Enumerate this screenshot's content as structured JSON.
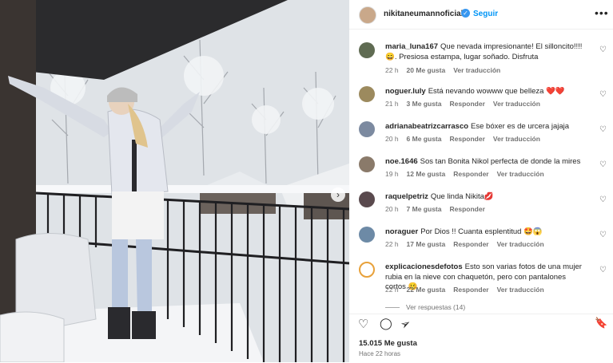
{
  "post": {
    "username": "nikitaneumannoficial",
    "follow_label": "Seguir",
    "more_label": "•••",
    "next_label": "›"
  },
  "comments": [
    {
      "user": "maria_luna167",
      "text": "Que nevada impresionante! El sillon­cito!!!!😄. Presiosa estampa, lugar soñado. Disfruta",
      "time": "22 h",
      "likes": "20 Me gusta",
      "reply": "",
      "translate": "Ver traducción"
    },
    {
      "user": "noguer.luly",
      "text": "Está nevando wowww que belleza ❤️❤️",
      "time": "21 h",
      "likes": "3 Me gusta",
      "reply": "Responder",
      "translate": "Ver traducción"
    },
    {
      "user": "adrianabeatrizcarrasco",
      "text": "Ese bóxer es de urcera jajaja",
      "time": "20 h",
      "likes": "6 Me gusta",
      "reply": "Responder",
      "translate": "Ver traducción"
    },
    {
      "user": "noe.1646",
      "text": "Sos tan Bonita Nikol perfecta de donde la mires",
      "time": "19 h",
      "likes": "12 Me gusta",
      "reply": "Responder",
      "translate": "Ver traducción"
    },
    {
      "user": "raquelpetriz",
      "text": "Que linda Nikita💋",
      "time": "20 h",
      "likes": "7 Me gusta",
      "reply": "Responder",
      "translate": ""
    },
    {
      "user": "noraguer",
      "text": "Por Dios !! Cuanta esplentitud 🤩😱",
      "time": "22 h",
      "likes": "17 Me gusta",
      "reply": "Responder",
      "translate": "Ver traducción"
    },
    {
      "user": "explicacionesdefotos",
      "text": "Esto son varias fotos de una mujer rubia en la nieve con chaquetón, pero con pantalones cortos 🥴",
      "time": "22 h",
      "likes": "22 Me gusta",
      "reply": "Responder",
      "translate": "Ver traducción"
    }
  ],
  "view_replies": "Ver respuestas (14)",
  "footer": {
    "likes": "15.015 Me gusta",
    "time": "Hace 22 horas"
  },
  "icons": {
    "heart": "♡",
    "comment": "◯",
    "share": "➢",
    "bookmark": "🔖"
  }
}
